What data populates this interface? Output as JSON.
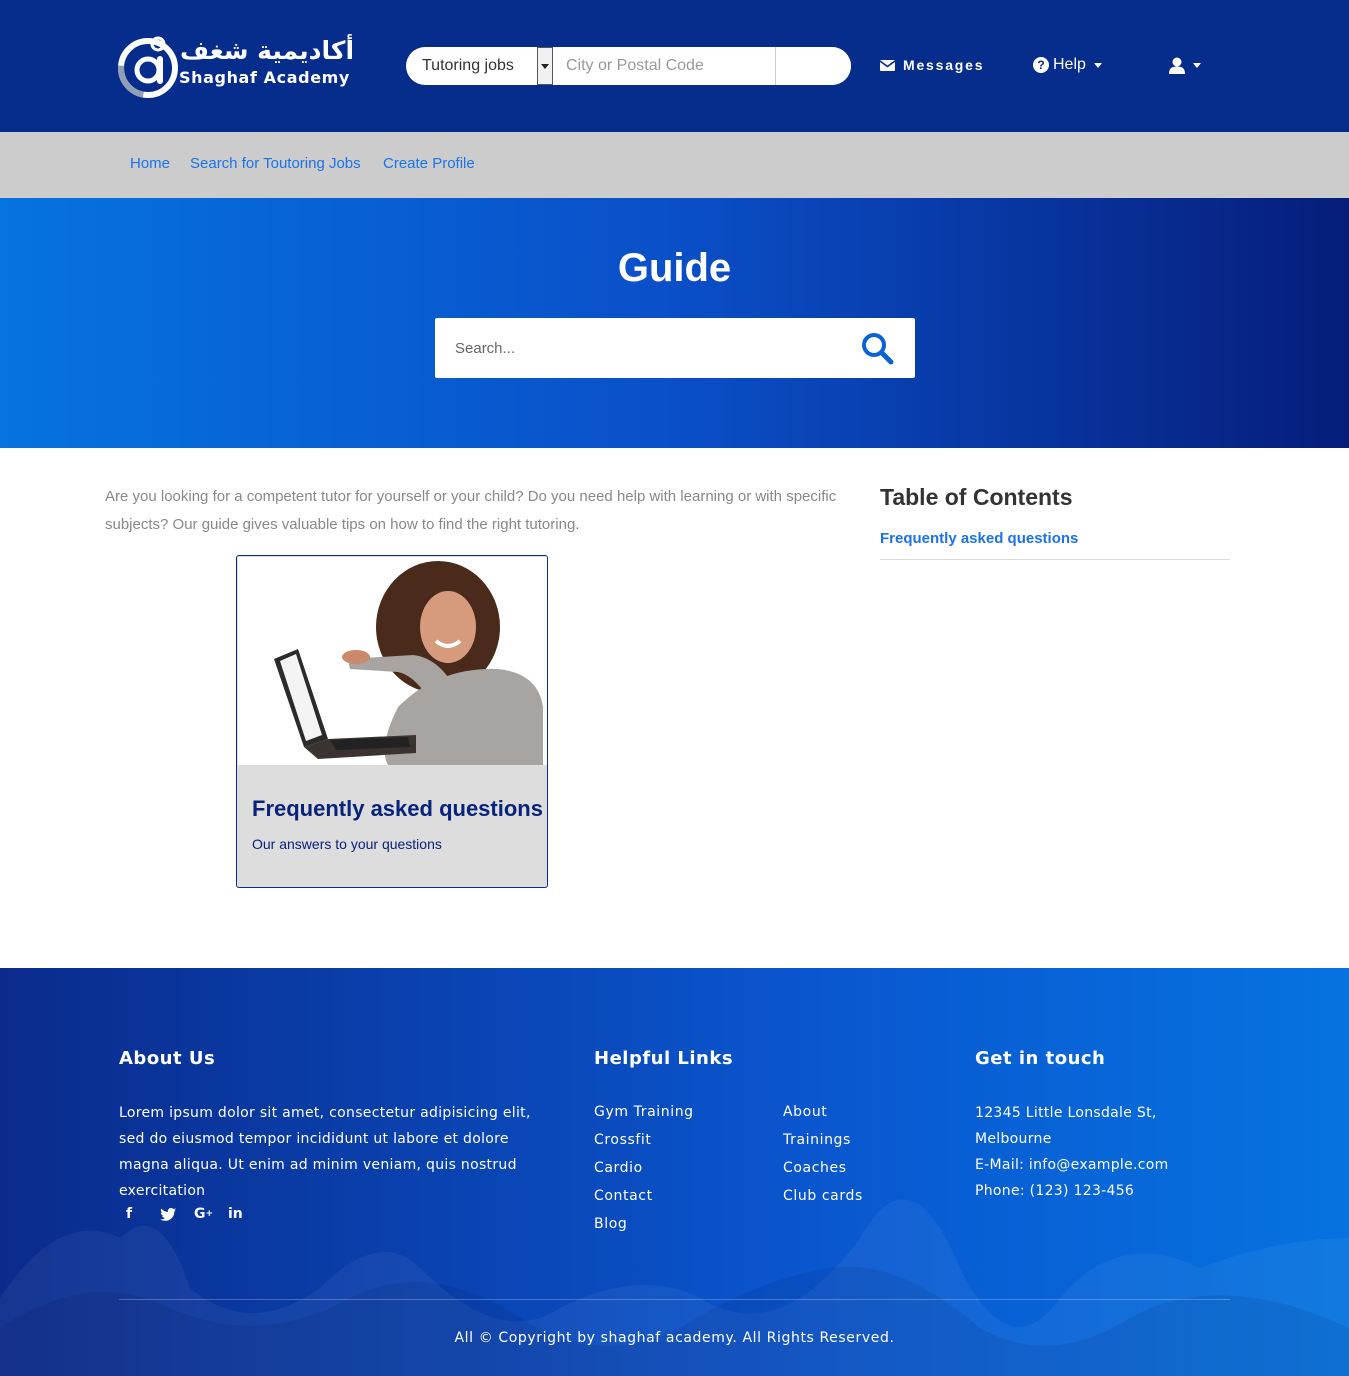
{
  "brand": {
    "logo_arabic": "أكاديمية شغف",
    "logo_english": "Shaghaf Academy",
    "primary_color": "#062c8c",
    "link_color": "#1a73e8"
  },
  "header": {
    "job_type_selected": "Tutoring jobs",
    "city_placeholder": "City or Postal Code",
    "messages_label": "Messages",
    "help_label": "Help",
    "icons": {
      "messages": "envelope-icon",
      "help": "question-circle-icon",
      "user": "user-icon"
    }
  },
  "subnav": {
    "home": "Home",
    "search_jobs": "Search for Toutoring Jobs",
    "create_profile": "Create Profile"
  },
  "hero": {
    "title": "Guide",
    "search_placeholder": "Search..."
  },
  "main": {
    "intro": "Are you looking for a competent tutor for yourself or your child? Do you need help with learning or with specific subjects? Our guide gives valuable tips on how to find the right tutoring.",
    "card": {
      "title": "Frequently asked questions",
      "subtitle": "Our answers to your questions"
    }
  },
  "toc": {
    "title": "Table of Contents",
    "items": [
      "Frequently asked questions"
    ]
  },
  "footer": {
    "about_heading": "About Us",
    "about_text": "Lorem ipsum dolor sit amet, consectetur adipisicing elit, sed do eiusmod tempor incididunt ut labore et dolore magna aliqua. Ut enim ad minim veniam, quis nostrud exercitation",
    "socials": [
      "facebook-icon",
      "twitter-icon",
      "google-plus-icon",
      "linkedin-icon"
    ],
    "links_heading": "Helpful Links",
    "links_col1": [
      "Gym Training",
      "Crossfit",
      "Cardio",
      "Contact",
      "Blog"
    ],
    "links_col2": [
      "About",
      "Trainings",
      "Coaches",
      "Club cards"
    ],
    "contact_heading": "Get in touch",
    "address_line1": "12345 Little Lonsdale St,",
    "address_line2": "Melbourne",
    "email": "E-Mail: info@example.com",
    "phone": "Phone: (123) 123-456",
    "copyright": "All © Copyright by shaghaf academy. All Rights Reserved."
  }
}
